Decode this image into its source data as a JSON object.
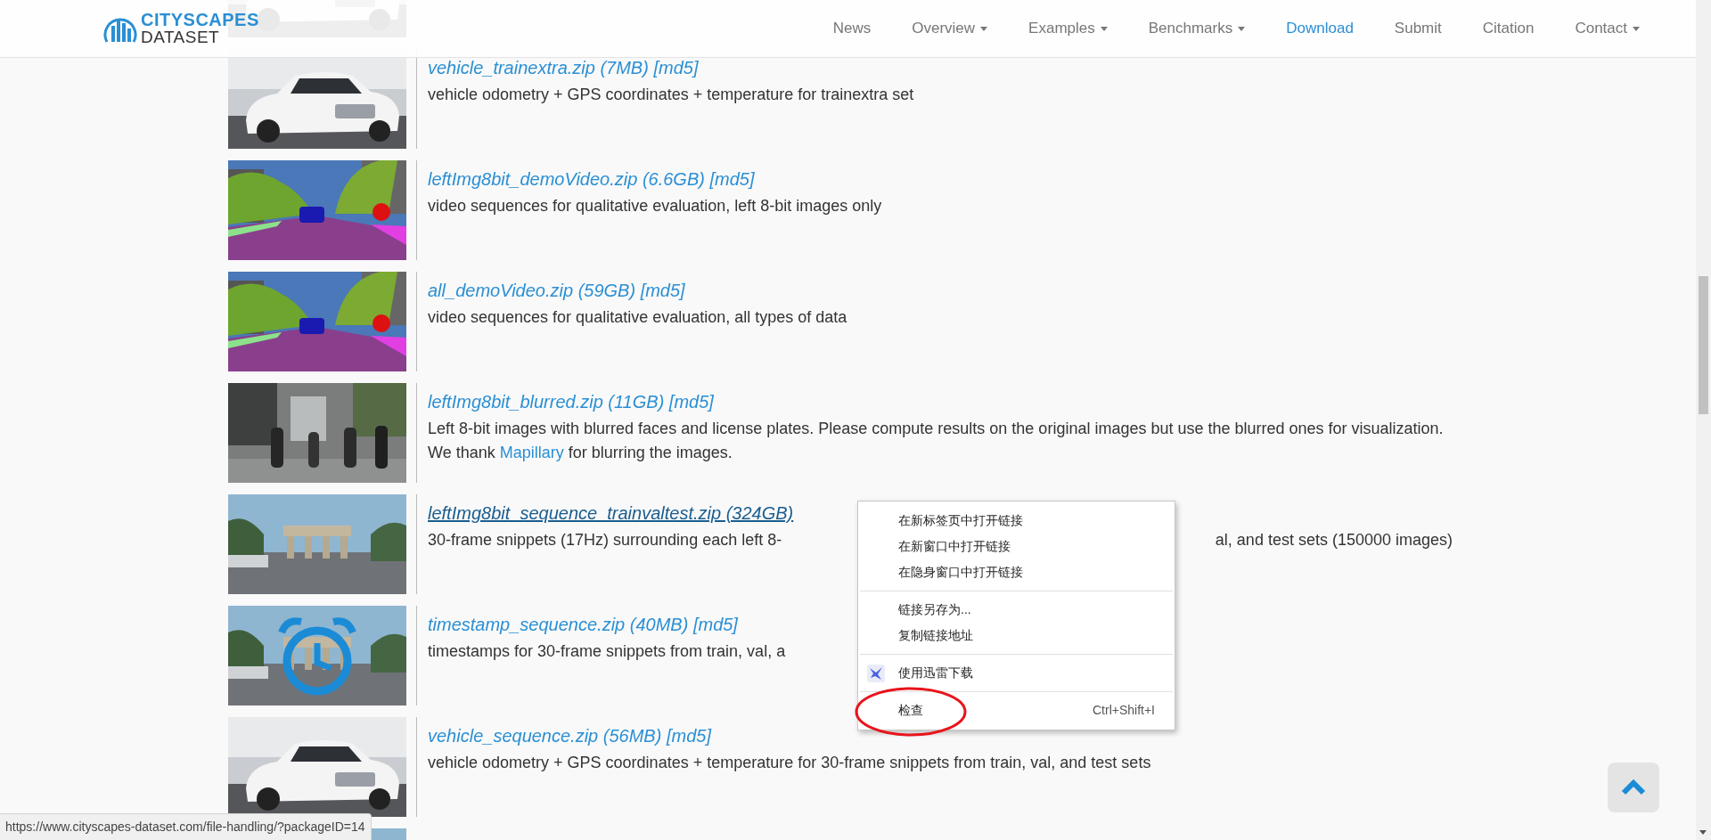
{
  "header": {
    "logo": {
      "title": "CITYSCAPES",
      "subtitle": "DATASET"
    },
    "nav": [
      {
        "label": "News",
        "selected": false,
        "dropdown": false
      },
      {
        "label": "Overview",
        "selected": false,
        "dropdown": true
      },
      {
        "label": "Examples",
        "selected": false,
        "dropdown": true
      },
      {
        "label": "Benchmarks",
        "selected": false,
        "dropdown": true
      },
      {
        "label": "Download",
        "selected": true,
        "dropdown": false
      },
      {
        "label": "Submit",
        "selected": false,
        "dropdown": false
      },
      {
        "label": "Citation",
        "selected": false,
        "dropdown": false
      },
      {
        "label": "Contact",
        "selected": false,
        "dropdown": true
      }
    ]
  },
  "packages": [
    {
      "title": "vehicle_trainextra.zip (7MB) [md5]",
      "hovered": false,
      "description": [
        {
          "kind": "text",
          "text": "vehicle odometry + GPS coordinates + temperature for trainextra set"
        }
      ]
    },
    {
      "title": "leftImg8bit_demoVideo.zip (6.6GB) [md5]",
      "hovered": false,
      "description": [
        {
          "kind": "text",
          "text": "video sequences for qualitative evaluation, left 8-bit images only"
        }
      ]
    },
    {
      "title": "all_demoVideo.zip (59GB) [md5]",
      "hovered": false,
      "description": [
        {
          "kind": "text",
          "text": "video sequences for qualitative evaluation, all types of data"
        }
      ]
    },
    {
      "title": "leftImg8bit_blurred.zip (11GB) [md5]",
      "hovered": false,
      "description": [
        {
          "kind": "text",
          "text": "Left 8-bit images with blurred faces and license plates. Please compute results on the original images but use the blurred ones for visualization. We thank "
        },
        {
          "kind": "link",
          "text": "Mapillary"
        },
        {
          "kind": "text",
          "text": " for blurring the images."
        }
      ]
    },
    {
      "title": "leftImg8bit_sequence_trainvaltest.zip (324GB)",
      "hovered": true,
      "description": [
        {
          "kind": "text",
          "text": "30-frame snippets (17Hz) surrounding each left 8-"
        }
      ],
      "description_tail": "al, and test sets (150000 images)"
    },
    {
      "title": "timestamp_sequence.zip (40MB) [md5]",
      "hovered": false,
      "description": [
        {
          "kind": "text",
          "text": "timestamps for 30-frame snippets from train, val, a"
        }
      ]
    },
    {
      "title": "vehicle_sequence.zip (56MB) [md5]",
      "hovered": false,
      "description": [
        {
          "kind": "text",
          "text": "vehicle odometry + GPS coordinates + temperature for 30-frame snippets from train, val, and test sets"
        }
      ]
    }
  ],
  "context_menu": [
    {
      "kind": "item",
      "label": "在新标签页中打开链接"
    },
    {
      "kind": "item",
      "label": "在新窗口中打开链接"
    },
    {
      "kind": "item",
      "label": "在隐身窗口中打开链接"
    },
    {
      "kind": "separator"
    },
    {
      "kind": "item",
      "label": "链接另存为..."
    },
    {
      "kind": "item",
      "label": "复制链接地址"
    },
    {
      "kind": "separator"
    },
    {
      "kind": "icon_item",
      "label": "使用迅雷下载"
    },
    {
      "kind": "separator"
    },
    {
      "kind": "item",
      "label": "检查",
      "shortcut": "Ctrl+Shift+I"
    }
  ],
  "status_bar": "https://www.cityscapes-dataset.com/file-handling/?packageID=14"
}
